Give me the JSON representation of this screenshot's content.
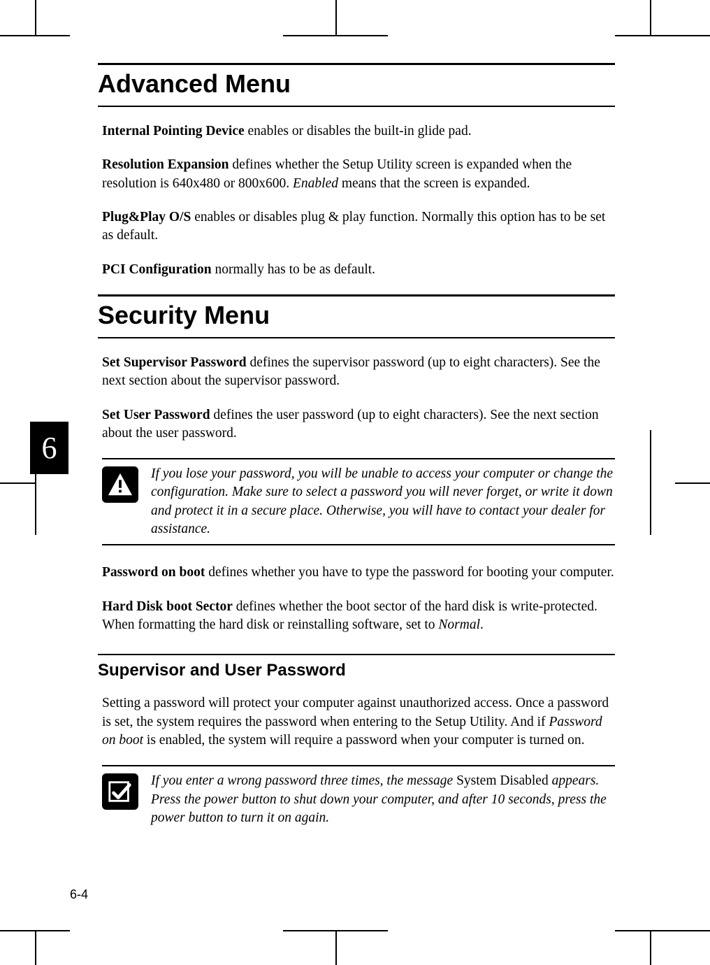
{
  "chapter_number": "6",
  "page_number": "6-4",
  "sections": {
    "advanced": {
      "title": "Advanced Menu",
      "p1_bold": "Internal Pointing Device",
      "p1_rest": " enables or disables the built-in glide pad.",
      "p2_bold": "Resolution Expansion",
      "p2_a": " defines whether the Setup Utility screen is expanded when the resolution is 640x480 or 800x600.  ",
      "p2_i": "Enabled",
      "p2_b": " means that the screen is expanded.",
      "p3_bold": "Plug&Play O/S",
      "p3_rest": " enables or disables plug & play function. Normally this option has to be set as default.",
      "p4_bold": "PCI Configuration",
      "p4_rest": " normally has to be as default."
    },
    "security": {
      "title": "Security Menu",
      "p1_bold": "Set Supervisor Password",
      "p1_rest": " defines the supervisor password (up to eight characters). See the next section about the supervisor password.",
      "p2_bold": "Set User Password",
      "p2_rest": " defines the user password (up to eight characters). See the next section about the user password.",
      "warn": "If you lose your password, you will be unable to access your computer or change the configuration. Make sure to select a password you will never forget, or write it down and protect it in a secure place. Otherwise, you will have to contact your dealer for assistance.",
      "p3_bold": "Password on boot",
      "p3_rest": " defines whether you have to type the password for booting your computer.",
      "p4_bold": "Hard Disk boot Sector",
      "p4_a": " defines whether the boot sector of the hard disk is write-protected. When formatting the hard disk or reinstalling software, set to ",
      "p4_i": "Normal",
      "p4_b": "."
    },
    "supuser": {
      "title": "Supervisor and User Password",
      "p1_a": "Setting a password will protect your computer against unauthorized access. Once a password is set, the system requires the password when entering to the Setup Utility. And if ",
      "p1_i": "Password on boot",
      "p1_b": " is enabled, the system will require a password when your computer is turned on.",
      "note_a": "If you enter a wrong password three times, the message ",
      "note_roman": "System Disabled",
      "note_b": " appears. Press the power button to shut down your computer, and after 10 seconds, press the power button to turn it on again."
    }
  },
  "icons": {
    "warning": "warning-icon",
    "check": "check-icon"
  }
}
